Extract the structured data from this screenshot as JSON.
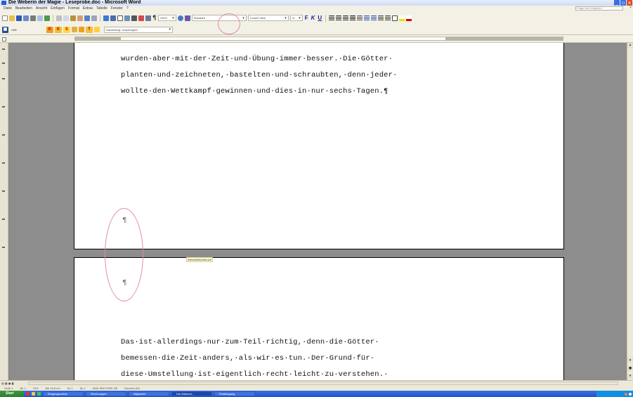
{
  "window": {
    "title": "Die Weberin der Magie - Leseprobe.doc - Microsoft Word",
    "min_label": "_",
    "max_label": "▫",
    "close_label": "x"
  },
  "menu": {
    "items": [
      "Datei",
      "Bearbeiten",
      "Ansicht",
      "Einfügen",
      "Format",
      "Extras",
      "Tabelle",
      "Fenster",
      "?"
    ],
    "help_placeholder": "Frage hier eingeben",
    "close_doc": "×"
  },
  "toolbar": {
    "zoom": "100%",
    "style_combo": "Standard",
    "font_combo": "Courier New",
    "size_combo": "11",
    "bold": "F",
    "italic": "K",
    "underline": "U",
    "pilcrow": "¶",
    "research_label": "Hilfe",
    "letter_k": "K",
    "letter_k2": "K",
    "letter_s": "S",
    "letter_t": "T",
    "style2_combo": "Darstellung: Ursprünglich"
  },
  "document": {
    "page1_lines": [
      "wurden·aber·mit·der·Zeit·und·Übung·immer·besser.·Die·Götter·",
      "planten·und·zeichneten,·bastelten·und·schraubten,·denn·jeder·",
      "wollte·den·Wettkampf·gewinnen·und·dies·in·nur·sechs·Tagen.¶"
    ],
    "pilcrow_empty": "¶",
    "section_break_label": "Abschnittsumbruch",
    "page2_lines": [
      "Das·ist·allerdings·nur·zum·Teil·richtig,·denn·die·Götter·",
      "bemessen·die·Zeit·anders,·als·wir·es·tun.·Der·Grund·für·",
      "diese·Umstellung·ist·eigentlich·recht·leicht·zu·verstehen.·"
    ]
  },
  "statusbar": {
    "page": "Seite 1",
    "section": "Ab 1",
    "pages": "1/24",
    "position": "Bei 19,8 cm",
    "line": "Ze 1",
    "column": "Sp 1",
    "modes": "MAK  ÄND  ERW  ÜB",
    "language": "Deutsch (De"
  },
  "taskbar": {
    "start_label": "Start",
    "tasks": [
      "Eingangsordner",
      "Rechnungen",
      "Allgemein",
      "Die Weberin...",
      "Posteingang"
    ],
    "active_index": 3
  },
  "colors": {
    "canvas_grey": "#8d8d8d",
    "annotation_oval": "#e08aa3",
    "taskbar_blue": "#2453c5",
    "start_green": "#2d7d2d"
  }
}
